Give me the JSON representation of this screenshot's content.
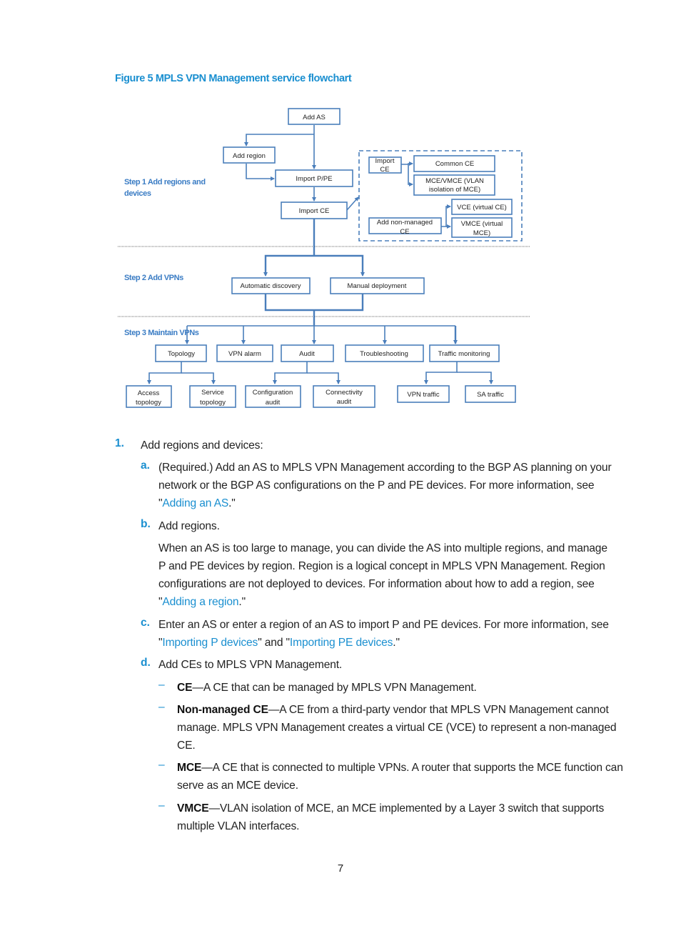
{
  "figure": {
    "title": "Figure 5 MPLS VPN Management service flowchart",
    "steps": {
      "step1_line1": "Step 1 Add regions and",
      "step1_line2": "devices",
      "step2": "Step 2  Add VPNs",
      "step3": "Step 3 Maintain VPNs"
    },
    "nodes": {
      "add_as": "Add AS",
      "add_region": "Add region",
      "import_ppe": "Import P/PE",
      "import_ce": "Import CE",
      "import_ce_inner_1": "Import",
      "import_ce_inner_2": "CE",
      "common_ce": "Common CE",
      "mce_vmce_1": "MCE/VMCE (VLAN",
      "mce_vmce_2": "isolation of MCE)",
      "add_nonmanaged_1": "Add non-managed",
      "add_nonmanaged_2": "CE",
      "vce": "VCE (virtual CE)",
      "vmce_1": "VMCE (virtual",
      "vmce_2": "MCE)",
      "auto_discovery": "Automatic discovery",
      "manual_deploy": "Manual deployment",
      "topology": "Topology",
      "vpn_alarm": "VPN alarm",
      "audit": "Audit",
      "troubleshooting": "Troubleshooting",
      "traffic_monitoring": "Traffic monitoring",
      "access_topology_1": "Access",
      "access_topology_2": "topology",
      "service_topology_1": "Service",
      "service_topology_2": "topology",
      "config_audit_1": "Configuration",
      "config_audit_2": "audit",
      "conn_audit_1": "Connectivity",
      "conn_audit_2": "audit",
      "vpn_traffic": "VPN traffic",
      "sa_traffic": "SA traffic"
    }
  },
  "steps_list": {
    "item1": {
      "num": "1.",
      "text": "Add regions and devices:"
    },
    "a": {
      "label": "a.",
      "line1": "(Required.) Add an AS to MPLS VPN Management according to the BGP AS planning on your",
      "line2": "network or the BGP AS configurations on the P and PE devices. For more information, see",
      "pre": "\"",
      "link": "Adding an AS",
      "post": ".\""
    },
    "b": {
      "label": "b.",
      "text": "Add regions.",
      "para1": "When an AS is too large to manage, you can divide the AS into multiple regions, and manage",
      "para2": "P and PE devices by region. Region is a logical concept in MPLS VPN Management. Region",
      "para3": "configurations are not deployed to devices. For information about how to add a region, see",
      "pre": "\"",
      "link": "Adding a region",
      "post": ".\""
    },
    "c": {
      "label": "c.",
      "line1": "Enter an AS or enter a region of an AS to import P and PE devices. For more information, see",
      "pre": "\"",
      "link1": "Importing P devices",
      "mid": "\" and \"",
      "link2": "Importing PE devices",
      "post": ".\""
    },
    "d": {
      "label": "d.",
      "text": "Add CEs to MPLS VPN Management.",
      "bullets": [
        {
          "term": "CE",
          "line1": "—A CE that can be managed by MPLS VPN Management.",
          "line2": "",
          "line3": ""
        },
        {
          "term": "Non-managed CE",
          "line1": "—A CE from a third-party vendor that MPLS VPN Management cannot",
          "line2": "manage. MPLS VPN Management creates a virtual CE (VCE) to represent a non-managed",
          "line3": "CE."
        },
        {
          "term": "MCE",
          "line1": "—A CE that is connected to multiple VPNs. A router that supports the MCE function can",
          "line2": "serve as an MCE device.",
          "line3": ""
        },
        {
          "term": "VMCE",
          "line1": "—VLAN isolation of MCE, an MCE implemented by a Layer 3 switch that supports",
          "line2": "multiple VLAN interfaces.",
          "line3": ""
        }
      ],
      "dash": "–"
    }
  },
  "page_number": "7"
}
